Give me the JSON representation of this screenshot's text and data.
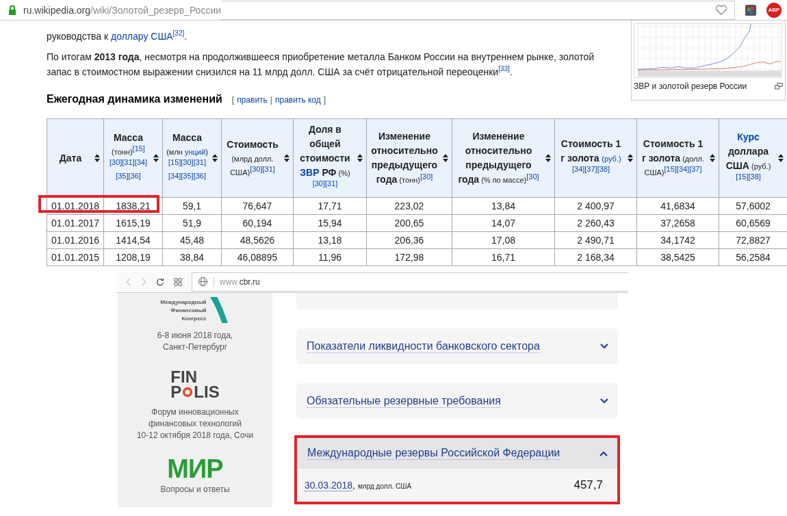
{
  "wiki_browser": {
    "url_domain": "ru.wikipedia.org",
    "url_path": "/wiki/Золотой_резерв_России",
    "extension_label": "ABP"
  },
  "article": {
    "paragraphs": [
      [
        {
          "text": "руководства к "
        },
        {
          "kind": "link",
          "text": "доллару США"
        },
        {
          "kind": "ref",
          "text": "[32]"
        },
        {
          "text": "."
        }
      ],
      [
        {
          "text": "По итогам "
        },
        {
          "kind": "bold",
          "text": "2013 года"
        },
        {
          "text": ", несмотря на продолжившееся приобретение металла Банком России на внутреннем рынке, золотой запас в стоимостном выражении снизился на 11 млрд долл. США за счёт отрицательной переоценки"
        },
        {
          "kind": "ref",
          "text": "[33]"
        },
        {
          "text": "."
        }
      ]
    ],
    "section_heading": "Ежегодная динамика изменений",
    "edit_open": "[",
    "edit_links": [
      "править",
      "править код"
    ],
    "edit_separator": "|",
    "edit_close": "]"
  },
  "figure": {
    "caption": "ЗВР и золотой резерв России"
  },
  "table": {
    "columns": [
      {
        "segments": [
          {
            "kind": "bold",
            "text": "Дата"
          }
        ]
      },
      {
        "segments": [
          {
            "kind": "bold",
            "text": "Масса"
          },
          {
            "kind": "note",
            "text": " (тонн)"
          },
          {
            "kind": "ref",
            "text": "[15]"
          },
          {
            "kind": "ref",
            "text": "[30]"
          },
          {
            "kind": "ref",
            "text": "[31]"
          },
          {
            "kind": "ref",
            "text": "[34]"
          },
          {
            "kind": "ref",
            "text": "[35]"
          },
          {
            "kind": "ref",
            "text": "[36]"
          }
        ]
      },
      {
        "segments": [
          {
            "kind": "bold",
            "text": "Масса"
          },
          {
            "kind": "note",
            "text": " (млн "
          },
          {
            "kind": "notelink",
            "text": "унций"
          },
          {
            "kind": "note",
            "text": ")"
          },
          {
            "kind": "ref",
            "text": "[15]"
          },
          {
            "kind": "ref",
            "text": "[30]"
          },
          {
            "kind": "ref",
            "text": "[31]"
          },
          {
            "kind": "ref",
            "text": "[34]"
          },
          {
            "kind": "ref",
            "text": "[35]"
          },
          {
            "kind": "ref",
            "text": "[36]"
          }
        ]
      },
      {
        "segments": [
          {
            "kind": "bold",
            "text": "Стоимость"
          },
          {
            "kind": "note",
            "text": " (млрд долл. США)"
          },
          {
            "kind": "ref",
            "text": "[30]"
          },
          {
            "kind": "ref",
            "text": "[31]"
          }
        ]
      },
      {
        "segments": [
          {
            "kind": "bold",
            "text": "Доля в общей стоимости "
          },
          {
            "kind": "boldlink",
            "text": "ЗВР"
          },
          {
            "kind": "bold",
            "text": " РФ"
          },
          {
            "kind": "note",
            "text": " (%)"
          },
          {
            "kind": "ref",
            "text": "[30]"
          },
          {
            "kind": "ref",
            "text": "[31]"
          }
        ]
      },
      {
        "segments": [
          {
            "kind": "bold",
            "text": "Изменение относительно предыдущего года"
          },
          {
            "kind": "note",
            "text": " (тонн)"
          },
          {
            "kind": "ref",
            "text": "[30]"
          }
        ]
      },
      {
        "segments": [
          {
            "kind": "bold",
            "text": "Изменение относительно предыдущего года"
          },
          {
            "kind": "note",
            "text": " (% по массе)"
          },
          {
            "kind": "ref",
            "text": "[30]"
          }
        ]
      },
      {
        "segments": [
          {
            "kind": "bold",
            "text": "Стоимость 1 г золота "
          },
          {
            "kind": "notelink",
            "text": "(руб.)"
          },
          {
            "kind": "ref",
            "text": "[34]"
          },
          {
            "kind": "ref",
            "text": "[37]"
          },
          {
            "kind": "ref",
            "text": "[38]"
          }
        ]
      },
      {
        "segments": [
          {
            "kind": "bold",
            "text": "Стоимость 1 г золота"
          },
          {
            "kind": "note",
            "text": " (долл. США)"
          },
          {
            "kind": "ref",
            "text": "[15]"
          },
          {
            "kind": "ref",
            "text": "[34]"
          },
          {
            "kind": "ref",
            "text": "[37]"
          }
        ]
      },
      {
        "segments": [
          {
            "kind": "boldlink",
            "text": "Курс"
          },
          {
            "kind": "bold",
            "text": " доллара США"
          },
          {
            "kind": "note",
            "text": " (руб.)"
          },
          {
            "kind": "ref",
            "text": "[15]"
          },
          {
            "kind": "ref",
            "text": "[38]"
          }
        ]
      }
    ],
    "rows": [
      {
        "highlighted": true,
        "cells": [
          "01.01.2018",
          "1838,21",
          "59,1",
          "76,647",
          "17,71",
          "223,02",
          "13,84",
          "2 400,97",
          "41,6834",
          "57,6002"
        ]
      },
      {
        "highlighted": false,
        "cells": [
          "01.01.2017",
          "1615,19",
          "51,9",
          "60,194",
          "15,94",
          "200,65",
          "14,07",
          "2 260,43",
          "37,2658",
          "60,6569"
        ]
      },
      {
        "highlighted": false,
        "cells": [
          "01.01.2016",
          "1414,54",
          "45,48",
          "48,5626",
          "13,18",
          "206,36",
          "17,08",
          "2 490,71",
          "34,1742",
          "72,8827"
        ]
      },
      {
        "highlighted": false,
        "cells": [
          "01.01.2015",
          "1208,19",
          "38,84",
          "46,08895",
          "11,96",
          "172,98",
          "16,71",
          "2 168,34",
          "38,5425",
          "56,2584"
        ]
      }
    ]
  },
  "cbr_browser": {
    "url_prefix": "www.",
    "url_domain": "cbr.ru"
  },
  "sidebar": {
    "events": [
      {
        "kind": "mfk",
        "logo_lines": [
          "Международный",
          "Финансовый",
          "Конгресс"
        ],
        "lines": [
          "6-8 июня 2018 года,",
          "Санкт-Петербург"
        ]
      },
      {
        "kind": "finopolis",
        "logo_top": "FIN",
        "logo_bottom_left": "P",
        "logo_bottom_right": "LIS",
        "lines": [
          "Форум инновационных",
          "финансовых технологий",
          "10-12 октября 2018 года, Сочи"
        ]
      },
      {
        "kind": "mir",
        "logo": "МИР",
        "lines": [
          "Вопросы и ответы"
        ]
      }
    ]
  },
  "accordion": [
    {
      "title": "Показатели ликвидности банковского сектора",
      "expanded": false,
      "highlighted": false
    },
    {
      "title": "Обязательные резервные требования",
      "expanded": false,
      "highlighted": false
    },
    {
      "title": "Международные резервы Российской Федерации",
      "expanded": true,
      "highlighted": true,
      "date": "30.03.2018",
      "date_separator": ",",
      "unit": "млрд долл. США",
      "value": "457,7"
    }
  ]
}
